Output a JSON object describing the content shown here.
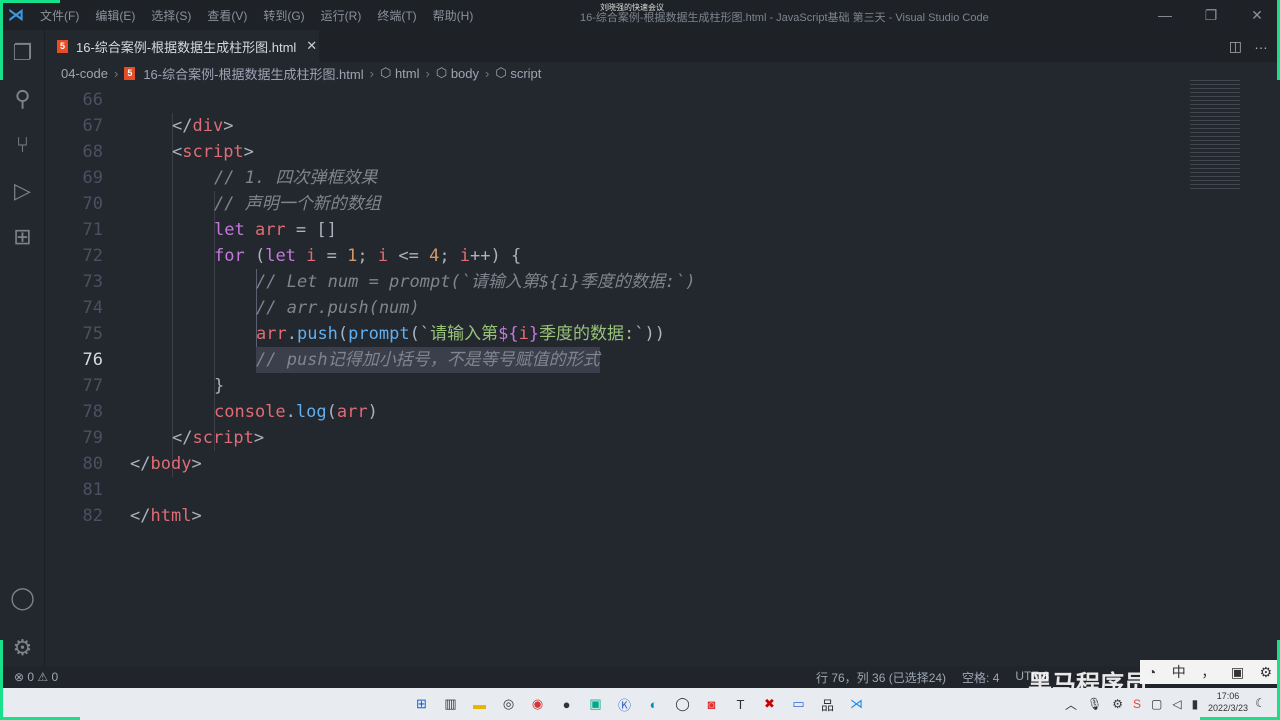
{
  "menu": [
    "文件(F)",
    "编辑(E)",
    "选择(S)",
    "查看(V)",
    "转到(G)",
    "运行(R)",
    "终端(T)",
    "帮助(H)"
  ],
  "window_title": "16-综合案例-根据数据生成柱形图.html - JavaScript基础 第三天 - Visual Studio Code",
  "meeting": "刘晓强的快速会议",
  "tab": {
    "label": "16-综合案例-根据数据生成柱形图.html"
  },
  "breadcrumb": [
    "04-code",
    "16-综合案例-根据数据生成柱形图.html",
    "html",
    "body",
    "script"
  ],
  "lines": [
    {
      "n": "66",
      "indent": 0,
      "tokens": []
    },
    {
      "n": "67",
      "indent": 1,
      "tokens": [
        [
          "</",
          "plain"
        ],
        [
          "div",
          "tag"
        ],
        [
          ">",
          "plain"
        ]
      ]
    },
    {
      "n": "68",
      "indent": 1,
      "tokens": [
        [
          "<",
          "plain"
        ],
        [
          "script",
          "tag"
        ],
        [
          ">",
          "plain"
        ]
      ]
    },
    {
      "n": "69",
      "indent": 2,
      "tokens": [
        [
          "// 1. 四次弹框效果",
          "cm"
        ]
      ]
    },
    {
      "n": "70",
      "indent": 2,
      "tokens": [
        [
          "// 声明一个新的数组",
          "cm"
        ]
      ]
    },
    {
      "n": "71",
      "indent": 2,
      "tokens": [
        [
          "let ",
          "kw"
        ],
        [
          "arr",
          "var"
        ],
        [
          " = []",
          "plain"
        ]
      ]
    },
    {
      "n": "72",
      "indent": 2,
      "tokens": [
        [
          "for",
          "kw"
        ],
        [
          " (",
          "plain"
        ],
        [
          "let ",
          "kw"
        ],
        [
          "i",
          "var"
        ],
        [
          " = ",
          "plain"
        ],
        [
          "1",
          "num"
        ],
        [
          "; ",
          "plain"
        ],
        [
          "i",
          "var"
        ],
        [
          " <= ",
          "plain"
        ],
        [
          "4",
          "num"
        ],
        [
          "; ",
          "plain"
        ],
        [
          "i",
          "var"
        ],
        [
          "++) {",
          "plain"
        ]
      ]
    },
    {
      "n": "73",
      "indent": 3,
      "tokens": [
        [
          "// Let num = prompt(`请输入第${i}季度的数据:`)",
          "cm"
        ]
      ]
    },
    {
      "n": "74",
      "indent": 3,
      "tokens": [
        [
          "// arr.push(num)",
          "cm"
        ]
      ]
    },
    {
      "n": "75",
      "indent": 3,
      "tokens": [
        [
          "arr",
          "var"
        ],
        [
          ".",
          "plain"
        ],
        [
          "push",
          "fn"
        ],
        [
          "(",
          "plain"
        ],
        [
          "prompt",
          "fn"
        ],
        [
          "(`",
          "plain"
        ],
        [
          "请输入第",
          "str"
        ],
        [
          "${",
          "interp"
        ],
        [
          "i",
          "var"
        ],
        [
          "}",
          "interp"
        ],
        [
          "季度的数据:",
          "str"
        ],
        [
          "`))",
          "plain"
        ]
      ]
    },
    {
      "n": "76",
      "indent": 3,
      "current": true,
      "tokens": [
        [
          "// push记得加小括号，不是等号赋值的形式",
          "cm"
        ]
      ]
    },
    {
      "n": "77",
      "indent": 2,
      "tokens": [
        [
          "}",
          "plain"
        ]
      ]
    },
    {
      "n": "78",
      "indent": 2,
      "tokens": [
        [
          "console",
          "var"
        ],
        [
          ".",
          "plain"
        ],
        [
          "log",
          "fn"
        ],
        [
          "(",
          "plain"
        ],
        [
          "arr",
          "var"
        ],
        [
          ")",
          "plain"
        ]
      ]
    },
    {
      "n": "79",
      "indent": 1,
      "tokens": [
        [
          "</",
          "plain"
        ],
        [
          "script",
          "tag"
        ],
        [
          ">",
          "plain"
        ]
      ]
    },
    {
      "n": "80",
      "indent": 0,
      "tokens": [
        [
          "</",
          "plain"
        ],
        [
          "body",
          "tag"
        ],
        [
          ">",
          "plain"
        ]
      ]
    },
    {
      "n": "81",
      "indent": 0,
      "tokens": []
    },
    {
      "n": "82",
      "indent": 0,
      "tokens": [
        [
          "</",
          "plain"
        ],
        [
          "html",
          "tag"
        ],
        [
          ">",
          "plain"
        ]
      ]
    }
  ],
  "status": {
    "problems": "⊗ 0 ⚠ 0",
    "position": "行 76，列 36 (已选择24)",
    "spaces": "空格: 4",
    "encoding": "UTF-8"
  },
  "watermark": "黑马程序员",
  "ime": [
    "中",
    "，"
  ],
  "clock": {
    "time": "17:06",
    "date": "2022/3/23"
  }
}
